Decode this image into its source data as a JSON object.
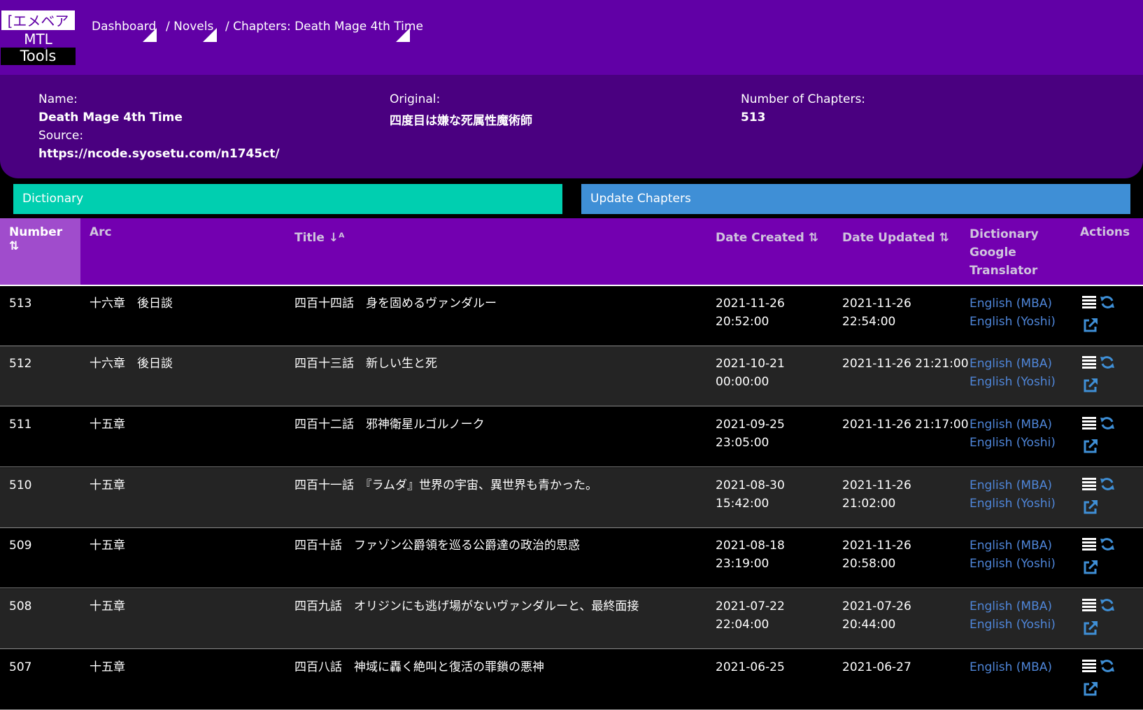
{
  "logo": {
    "line1": "[エメベアー]",
    "line2": "MTL",
    "line3": "Tools"
  },
  "breadcrumb": [
    {
      "label": "Dashboard"
    },
    {
      "label": "/ Novels"
    },
    {
      "label": "/ Chapters: Death Mage 4th Time"
    }
  ],
  "info": {
    "name_label": "Name:",
    "name_value": "Death Mage 4th Time",
    "source_label": "Source:",
    "source_value": "https://ncode.syosetu.com/n1745ct/",
    "original_label": "Original:",
    "original_value": "四度目は嫌な死属性魔術師",
    "chapters_label": "Number of Chapters:",
    "chapters_value": "513"
  },
  "buttons": {
    "dictionary": "Dictionary",
    "update": "Update Chapters"
  },
  "table": {
    "headers": {
      "number": "Number",
      "arc": "Arc",
      "title": "Title",
      "date_created": "Date Created",
      "date_updated": "Date Updated",
      "dictionary": "Dictionary",
      "google": "Google",
      "translator": "Translator",
      "actions": "Actions"
    },
    "rows": [
      {
        "number": "513",
        "arc": "十六章　後日談",
        "title": "四百十四話　身を固めるヴァンダルー",
        "created1": "2021-11-26",
        "created2": "20:52:00",
        "updated1": "2021-11-26",
        "updated2": "22:54:00",
        "link1": "English (MBA)",
        "link2": "English (Yoshi)"
      },
      {
        "number": "512",
        "arc": "十六章　後日談",
        "title": "四百十三話　新しい生と死",
        "created1": "2021-10-21",
        "created2": "00:00:00",
        "updated1": "2021-11-26 21:21:00",
        "updated2": "",
        "link1": "English (MBA)",
        "link2": "English (Yoshi)"
      },
      {
        "number": "511",
        "arc": "十五章",
        "title": "四百十二話　邪神衛星ルゴルノーク",
        "created1": "2021-09-25",
        "created2": "23:05:00",
        "updated1": "2021-11-26 21:17:00",
        "updated2": "",
        "link1": "English (MBA)",
        "link2": "English (Yoshi)"
      },
      {
        "number": "510",
        "arc": "十五章",
        "title": "四百十一話　『ラムダ』世界の宇宙、異世界も青かった。",
        "created1": "2021-08-30",
        "created2": "15:42:00",
        "updated1": "2021-11-26",
        "updated2": "21:02:00",
        "link1": "English (MBA)",
        "link2": "English (Yoshi)"
      },
      {
        "number": "509",
        "arc": "十五章",
        "title": "四百十話　ファゾン公爵領を巡る公爵達の政治的思惑",
        "created1": "2021-08-18",
        "created2": "23:19:00",
        "updated1": "2021-11-26",
        "updated2": "20:58:00",
        "link1": "English (MBA)",
        "link2": "English (Yoshi)"
      },
      {
        "number": "508",
        "arc": "十五章",
        "title": "四百九話　オリジンにも逃げ場がないヴァンダルーと、最終面接",
        "created1": "2021-07-22",
        "created2": "22:04:00",
        "updated1": "2021-07-26",
        "updated2": "20:44:00",
        "link1": "English (MBA)",
        "link2": "English (Yoshi)"
      },
      {
        "number": "507",
        "arc": "十五章",
        "title": "四百八話　神域に轟く絶叫と復活の罪鎖の悪神",
        "created1": "2021-06-25",
        "created2": "",
        "updated1": "2021-06-27",
        "updated2": "",
        "link1": "English (MBA)",
        "link2": ""
      }
    ]
  },
  "colors": {
    "topbar": "#6100a6",
    "info": "#4a0080",
    "dictionary_btn": "#00cfb0",
    "update_btn": "#3f8fd6",
    "link": "#4f86d9"
  }
}
